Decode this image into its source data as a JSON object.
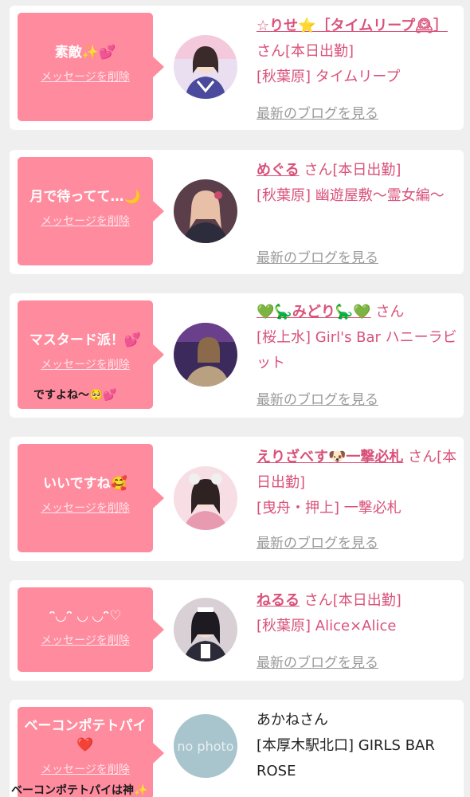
{
  "common": {
    "delete_label": "メッセージを削除",
    "san": "さん",
    "blog_label": "最新のブログを見る"
  },
  "messages": [
    {
      "message": "素敵✨💕",
      "cast_name": "☆りせ⭐️［タイムリープ🕰］",
      "status": "[本日出勤]",
      "shop": "[秋葉原] タイムリープ",
      "avatar_icon": "cast-photo"
    },
    {
      "message": "月で待ってて…🌙",
      "cast_name": "めぐる",
      "status": "[本日出勤]",
      "shop": "[秋葉原] 幽遊屋敷〜霊女編〜",
      "avatar_icon": "cast-photo"
    },
    {
      "message": "マスタード派！💕",
      "reply": "ですよね〜🥺💕",
      "cast_name": "💚🦕みどり🦕💚",
      "status": "",
      "shop": "[桜上水] Girl's Bar ハニーラビット",
      "avatar_icon": "cast-photo"
    },
    {
      "message": "いいですね🥰",
      "cast_name": "えりざべす🐶一撃必札",
      "status": "[本日出勤]",
      "shop": "[曳舟・押上] 一撃必札",
      "avatar_icon": "cast-photo"
    },
    {
      "message": "ᵔ◡ᵔ ◡ ◡ᵔ♡",
      "cast_name": "ねるる",
      "status": "[本日出勤]",
      "shop": "[秋葉原] Alice×Alice",
      "avatar_icon": "cast-photo"
    },
    {
      "message": "ベーコンポテトパイ❤️",
      "reply": "ベーコンポテトパイは神✨",
      "cast_name": "あかね",
      "status": "",
      "shop": "[本厚木駅北口] GIRLS BAR ROSE",
      "avatar_icon": "no-photo",
      "avatar_text": "no photo"
    }
  ],
  "colors": {
    "bubble": "#ff8b9e",
    "accent": "#d9527a",
    "muted": "#9a9a9a"
  }
}
